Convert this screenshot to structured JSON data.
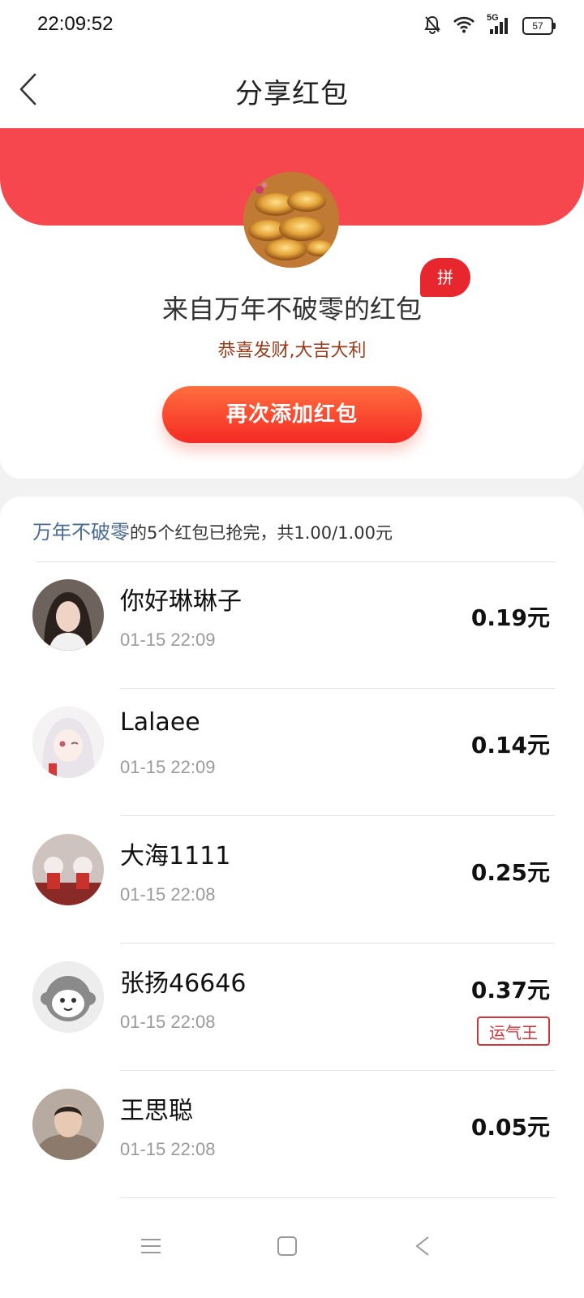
{
  "status": {
    "time": "22:09:52",
    "battery": "57",
    "network": "5G"
  },
  "nav": {
    "title": "分享红包"
  },
  "hero": {
    "pin_badge": "拼",
    "from_title": "来自万年不破零的红包",
    "blessing": "恭喜发财,大吉大利",
    "add_again_label": "再次添加红包"
  },
  "summary": {
    "sender": "万年不破零",
    "text": "的5个红包已抢完，共1.00/1.00元"
  },
  "records": [
    {
      "name": "你好琳琳子",
      "time": "01-15 22:09",
      "amount": "0.19元"
    },
    {
      "name": "Lalaee",
      "time": "01-15 22:09",
      "amount": "0.14元"
    },
    {
      "name": "大海1111",
      "time": "01-15 22:08",
      "amount": "0.25元"
    },
    {
      "name": "张扬46646",
      "time": "01-15 22:08",
      "amount": "0.37元",
      "badge": "运气王"
    },
    {
      "name": "王思聪",
      "time": "01-15 22:08",
      "amount": "0.05元"
    }
  ],
  "colors": {
    "accent_red": "#f6474e",
    "link_blue": "#4a6b94",
    "luck_red": "#d2343a"
  }
}
